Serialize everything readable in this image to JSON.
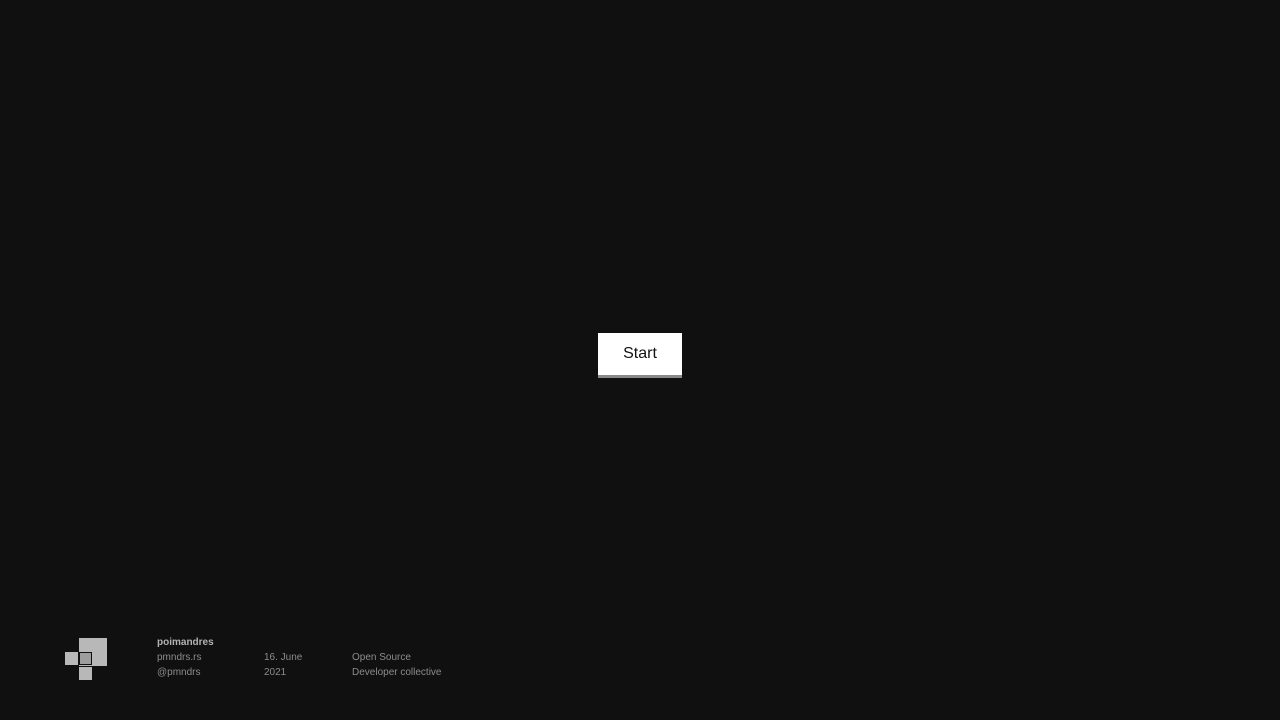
{
  "main": {
    "start_label": "Start"
  },
  "footer": {
    "logo_icon": "pmndrs-logo-icon",
    "brand": "poimandres",
    "website": "pmndrs.rs",
    "handle": "@pmndrs",
    "date_day": "16. June",
    "date_year": "2021",
    "tagline_1": "Open Source",
    "tagline_2": "Developer collective"
  },
  "colors": {
    "background": "#101010",
    "button_bg": "#ffffff",
    "footer_text": "#8c8c8c",
    "logo": "#b8b8b8"
  }
}
